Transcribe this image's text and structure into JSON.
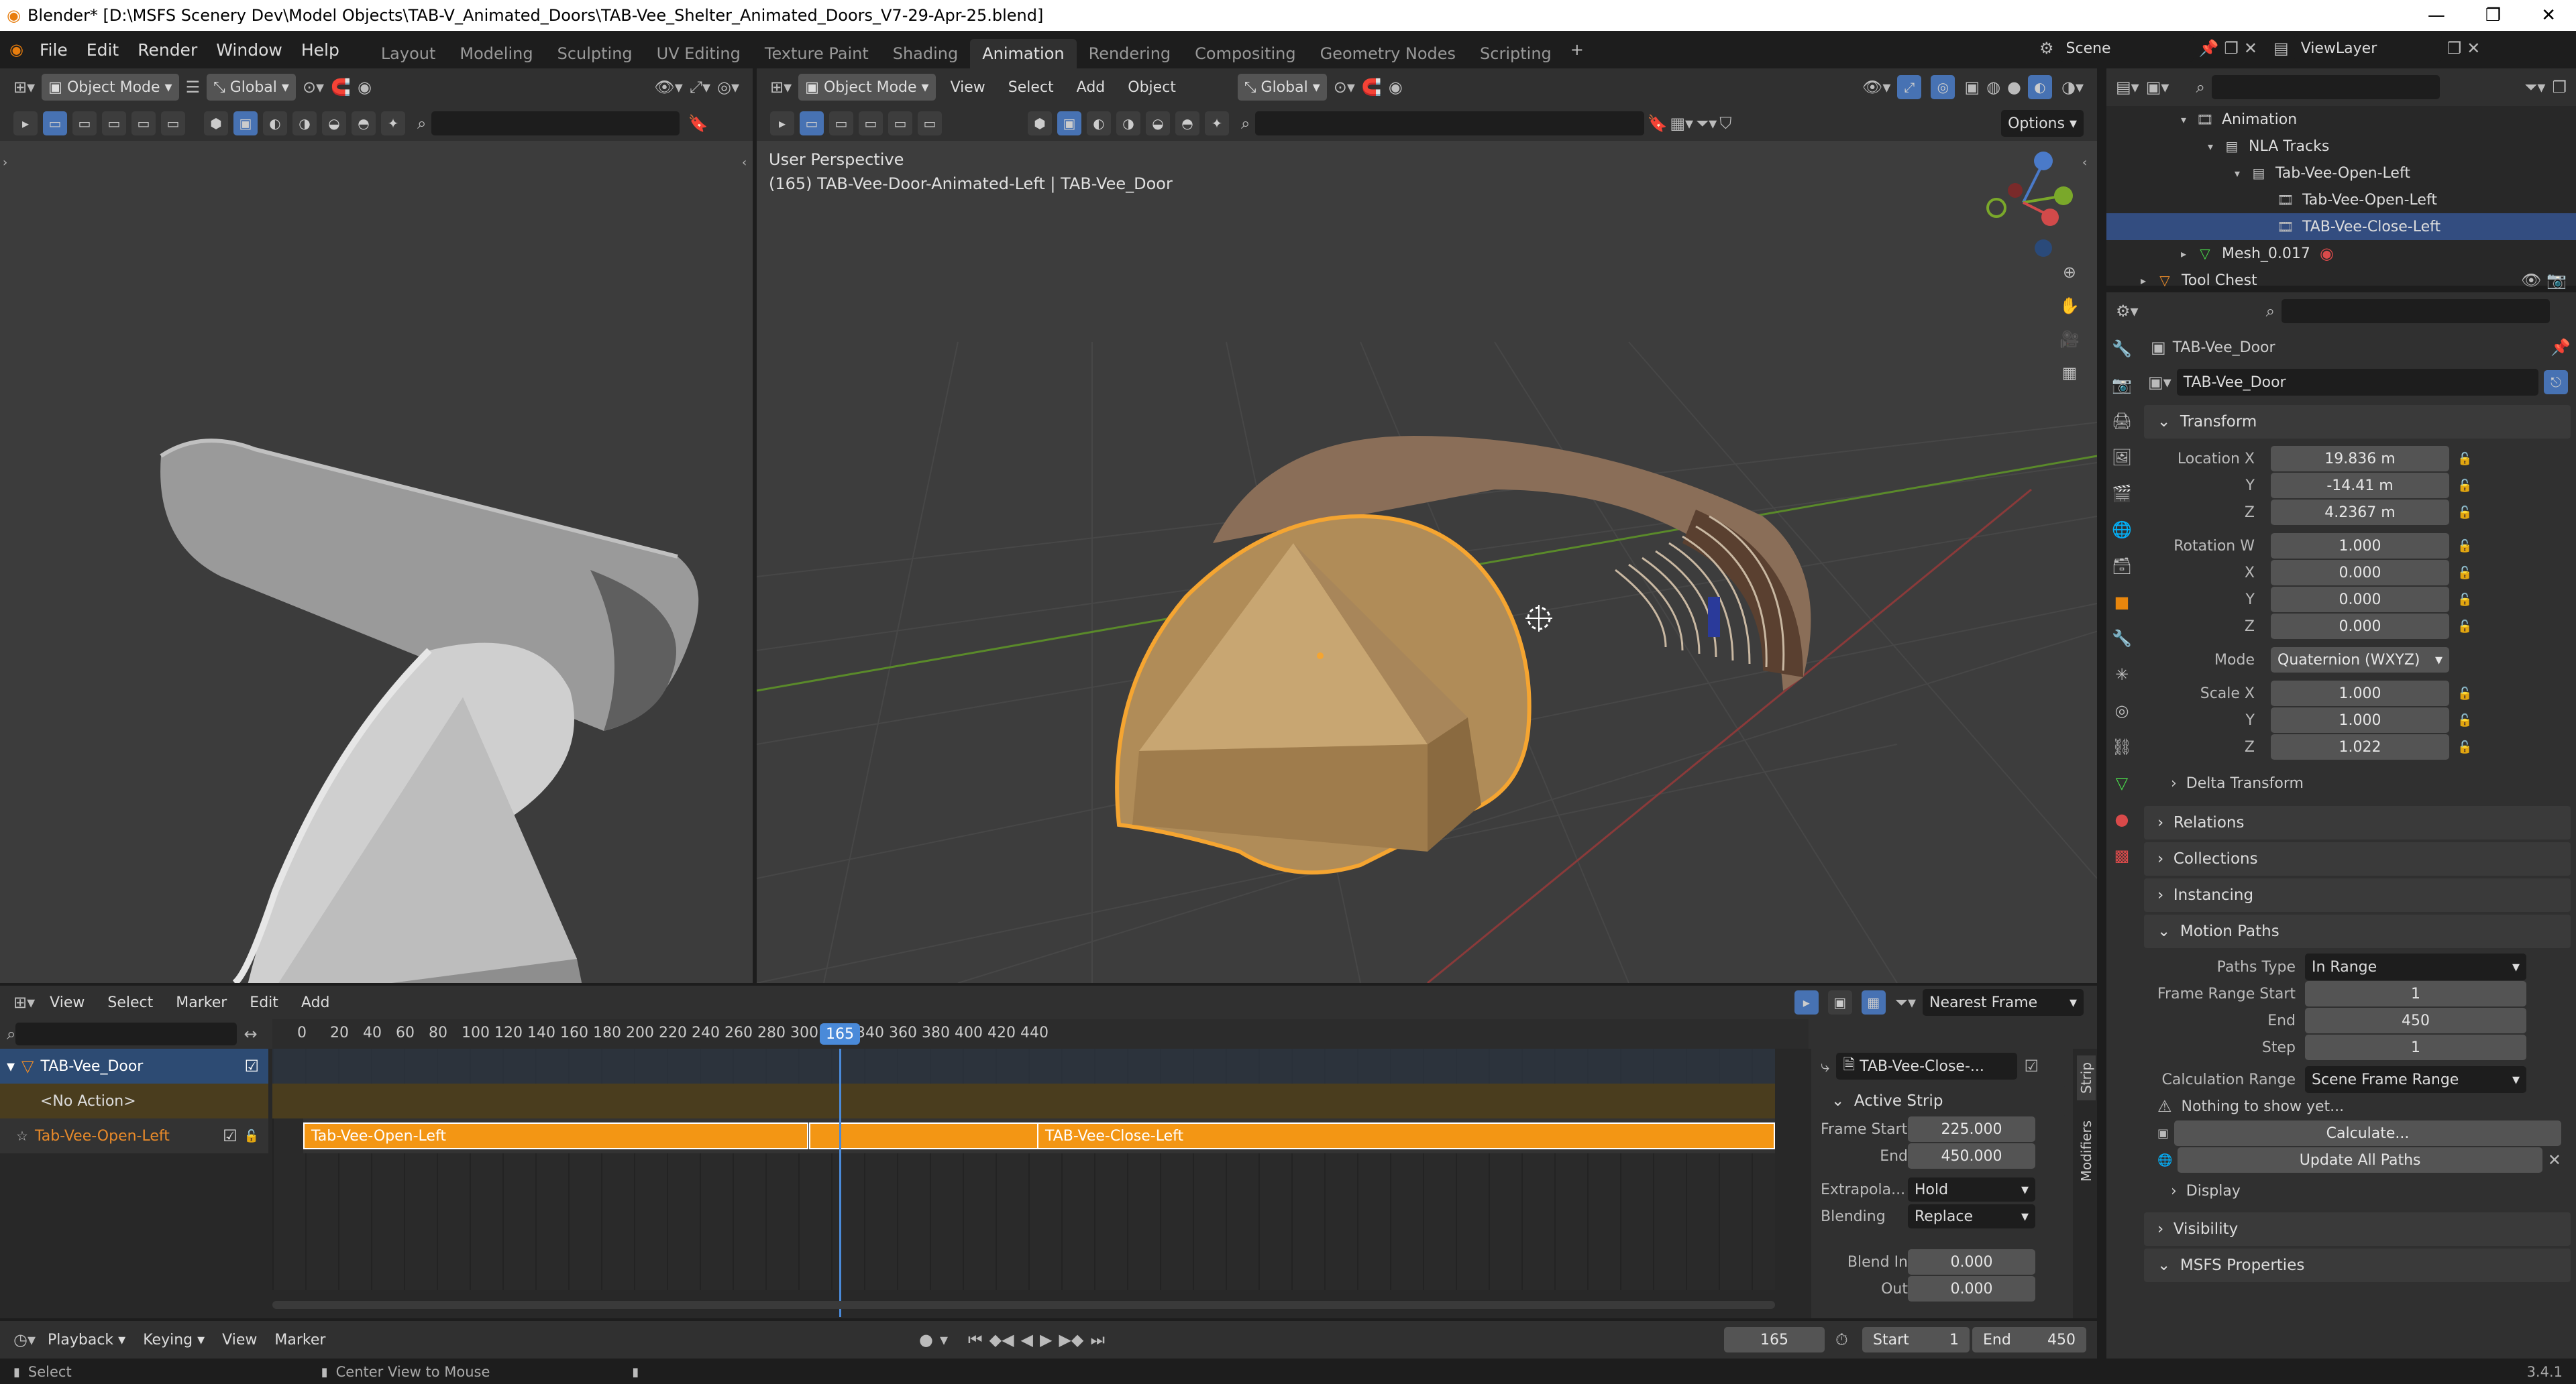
{
  "title_bar": {
    "text": "Blender* [D:\\MSFS Scenery Dev\\Model Objects\\TAB-V_Animated_Doors\\TAB-Vee_Shelter_Animated_Doors_V7-29-Apr-25.blend]"
  },
  "menu": {
    "file": "File",
    "edit": "Edit",
    "render": "Render",
    "window": "Window",
    "help": "Help"
  },
  "workspaces": [
    "Layout",
    "Modeling",
    "Sculpting",
    "UV Editing",
    "Texture Paint",
    "Shading",
    "Animation",
    "Rendering",
    "Compositing",
    "Geometry Nodes",
    "Scripting"
  ],
  "active_workspace": "Animation",
  "scene": {
    "label": "Scene",
    "view_layer": "ViewLayer"
  },
  "left_viewport": {
    "mode": "Object Mode",
    "orientation": "Global"
  },
  "main_viewport": {
    "mode": "Object Mode",
    "menus": [
      "View",
      "Select",
      "Add",
      "Object"
    ],
    "orientation": "Global",
    "options": "Options",
    "overlay_line1": "User Perspective",
    "overlay_line2": "(165) TAB-Vee-Door-Animated-Left | TAB-Vee_Door"
  },
  "outliner": {
    "items": [
      {
        "label": "Animation",
        "indent": 0
      },
      {
        "label": "NLA Tracks",
        "indent": 1
      },
      {
        "label": "Tab-Vee-Open-Left",
        "indent": 2
      },
      {
        "label": "Tab-Vee-Open-Left",
        "indent": 3
      },
      {
        "label": "TAB-Vee-Close-Left",
        "indent": 3,
        "selected": true
      },
      {
        "label": "Mesh_0.017",
        "indent": 0
      },
      {
        "label": "Tool Chest",
        "indent": -1
      }
    ]
  },
  "properties": {
    "object_name": "TAB-Vee_Door",
    "datablock_name": "TAB-Vee_Door",
    "transform_header": "Transform",
    "location": {
      "label": "Location X",
      "x": "19.836 m",
      "y": "-14.41 m",
      "z": "4.2367 m"
    },
    "rotation": {
      "label": "Rotation W",
      "w": "1.000",
      "x": "0.000",
      "y": "0.000",
      "z": "0.000"
    },
    "mode_label": "Mode",
    "mode_value": "Quaternion (WXYZ)",
    "scale": {
      "label": "Scale X",
      "x": "1.000",
      "y": "1.000",
      "z": "1.022"
    },
    "axis_y": "Y",
    "axis_z": "Z",
    "axis_x": "X",
    "delta": "Delta Transform",
    "relations": "Relations",
    "collections": "Collections",
    "instancing": "Instancing",
    "motion_paths": "Motion Paths",
    "paths_type_label": "Paths Type",
    "paths_type_value": "In Range",
    "frame_range_start_label": "Frame Range Start",
    "frame_range_start": "1",
    "end_label": "End",
    "end_value": "450",
    "step_label": "Step",
    "step_value": "1",
    "calc_range_label": "Calculation Range",
    "calc_range_value": "Scene Frame Range",
    "warning": "Nothing to show yet...",
    "calculate": "Calculate...",
    "update_all": "Update All Paths",
    "display": "Display",
    "visibility": "Visibility",
    "msfs": "MSFS Properties"
  },
  "nla": {
    "menus": [
      "View",
      "Select",
      "Marker",
      "Edit",
      "Add"
    ],
    "snap": "Nearest Frame",
    "ruler": [
      "0",
      "20",
      "40",
      "60",
      "80",
      "100",
      "120",
      "140",
      "160",
      "180",
      "200",
      "220",
      "240",
      "260",
      "280",
      "300",
      "320",
      "340",
      "360",
      "380",
      "400",
      "420",
      "440"
    ],
    "current_frame": "165",
    "object_track": "TAB-Vee_Door",
    "no_action": "<No Action>",
    "track_name": "Tab-Vee-Open-Left",
    "strip1": "Tab-Vee-Open-Left",
    "strip2": "TAB-Vee-Close-Left",
    "sidebar": {
      "strip_name": "TAB-Vee-Close-...",
      "active_strip": "Active Strip",
      "frame_start_label": "Frame Start",
      "frame_start": "225.000",
      "end_label": "End",
      "end": "450.000",
      "extrapolation_label": "Extrapola...",
      "extrapolation": "Hold",
      "blending_label": "Blending",
      "blending": "Replace",
      "blend_in_label": "Blend In",
      "blend_in": "0.000",
      "out_label": "Out",
      "out": "0.000",
      "tab_strip": "Strip",
      "tab_modifiers": "Modifiers"
    }
  },
  "timeline": {
    "playback": "Playback",
    "keying": "Keying",
    "view": "View",
    "marker": "Marker",
    "current": "165",
    "start_label": "Start",
    "start": "1",
    "end_label": "End",
    "end": "450"
  },
  "status": {
    "select": "Select",
    "center": "Center View to Mouse",
    "version": "3.4.1"
  }
}
